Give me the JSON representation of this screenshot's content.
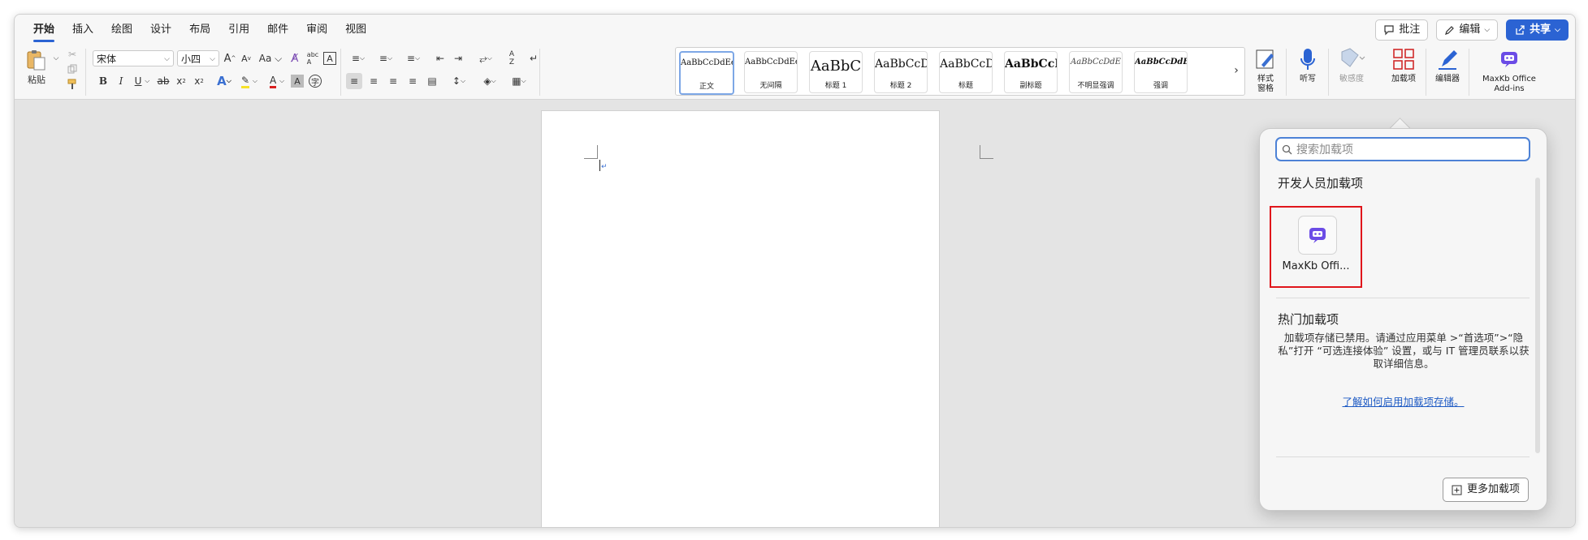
{
  "tabs": [
    "开始",
    "插入",
    "绘图",
    "设计",
    "布局",
    "引用",
    "邮件",
    "审阅",
    "视图"
  ],
  "active_tab": "开始",
  "top_right": {
    "comments": "批注",
    "editing": "编辑",
    "share": "共享"
  },
  "clipboard": {
    "paste": "粘贴"
  },
  "font": {
    "name": "宋体",
    "size": "小四"
  },
  "styles": [
    {
      "sample": "AaBbCcDdEe",
      "name": "正文"
    },
    {
      "sample": "AaBbCcDdEe",
      "name": "无间隔"
    },
    {
      "sample": "AaBbC",
      "name": "标题 1"
    },
    {
      "sample": "AaBbCcD",
      "name": "标题 2"
    },
    {
      "sample": "AaBbCcD",
      "name": "标题"
    },
    {
      "sample": "AaBbCcD",
      "name": "副标题"
    },
    {
      "sample": "AaBbCcDdE",
      "name": "不明显强调"
    },
    {
      "sample": "AaBbCcDdE",
      "name": "强调"
    }
  ],
  "tools": {
    "styles_pane": "样式\n窗格",
    "dictate": "听写",
    "sensitivity": "敏感度",
    "addins": "加载项",
    "editor": "编辑器",
    "maxkb": "MaxKb Office\nAdd-ins"
  },
  "panel": {
    "search_placeholder": "搜索加载项",
    "dev_section": "开发人员加载项",
    "addin_name": "MaxKb Offi...",
    "popular_section": "热门加载项",
    "notice": "加载项存储已禁用。请通过应用菜单 >“首选项”>“隐私”打开 “可选连接体验” 设置，或与 IT 管理员联系以获取详细信息。",
    "link": "了解如何启用加载项存储。",
    "more_button": "更多加载项"
  },
  "colors": {
    "accent": "#2b63d3",
    "highlight_box": "#e0151b",
    "link": "#1f5bc4",
    "addin_icon": "#6b4ce6"
  }
}
